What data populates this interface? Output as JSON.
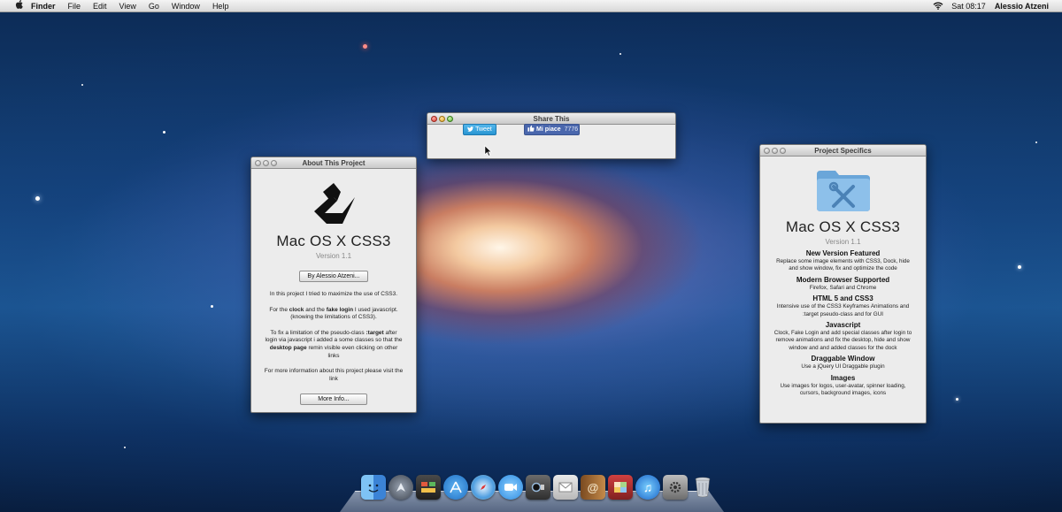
{
  "menubar": {
    "apple": "",
    "items": [
      "Finder",
      "File",
      "Edit",
      "View",
      "Go",
      "Window",
      "Help"
    ],
    "clock": "Sat 08:17",
    "user": "Alessio Atzeni"
  },
  "share_window": {
    "title": "Share This",
    "tweet_label": "Tweet",
    "like_label": "Mi piace",
    "like_count": "7776"
  },
  "about_window": {
    "title": "About This Project",
    "app_name": "Mac OS X CSS3",
    "version": "Version 1.1",
    "author_button": "By Alessio Atzeni...",
    "p1": "In this project I tried to maximize the use of CSS3.",
    "p2_a": "For the ",
    "p2_b": "clock",
    "p2_c": " and the ",
    "p2_d": "fake login",
    "p2_e": " I used javascript. (knowing the limitations of CSS3).",
    "p3_a": "To fix a limitation of the pseudo-class ",
    "p3_b": ":target",
    "p3_c": " after login via javascript i added a some classes so that the ",
    "p3_d": "desktop page",
    "p3_e": " remin visible even clicking on other links",
    "p4": "For more information about this project please visit the link",
    "more_button": "More Info..."
  },
  "specifics_window": {
    "title": "Project Specifics",
    "app_name": "Mac OS X CSS3",
    "version": "Version 1.1",
    "sections": [
      {
        "heading": "New Version Featured",
        "text": "Replace some image elements with CSS3, Dock, hide and show window, fix and optimize the code"
      },
      {
        "heading": "Modern Browser Supported",
        "text": "Firefox, Safari and Chrome"
      },
      {
        "heading": "HTML 5 and CSS3",
        "text": "Intensive use of the CSS3 Keyframes Animations and :target pseudo-class and for GUI"
      },
      {
        "heading": "Javascript",
        "text": "Clock, Fake Login and add special classes after login to remove animations and fix the desktop, hide and show window and and added classes for the dock"
      },
      {
        "heading": "Draggable Window",
        "text": "Use a jQuery UI Draggable plugin"
      },
      {
        "heading": "Images",
        "text": "Use images for logos, user-avatar, spinner loading, cursors, background images, icons"
      }
    ]
  },
  "dock": {
    "icons": [
      "finder-icon",
      "launchpad-icon",
      "mission-control-icon",
      "app-store-icon",
      "safari-icon",
      "ichat-icon",
      "facetime-icon",
      "mail-icon",
      "address-book-icon",
      "photo-booth-icon",
      "itunes-icon",
      "system-preferences-icon",
      "trash-icon"
    ]
  },
  "colors": {
    "tweet": "#2895d2",
    "facebook": "#4a67ad",
    "folder": "#7fb4e0"
  }
}
